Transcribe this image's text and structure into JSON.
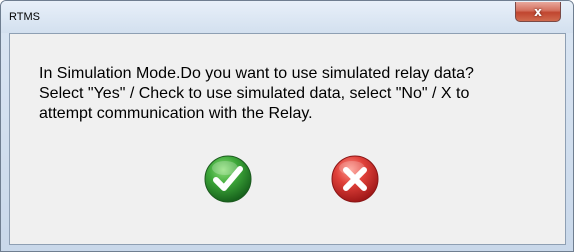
{
  "window": {
    "title": "RTMS",
    "close_glyph": "x"
  },
  "dialog": {
    "message_lines": [
      "In Simulation Mode.Do you want to use simulated relay data?",
      "Select \"Yes\" / Check to use simulated data, select \"No\" / X to",
      "attempt communication with the Relay."
    ]
  },
  "buttons": {
    "yes": {
      "icon": "check-icon",
      "color": "#2e8b2e"
    },
    "no": {
      "icon": "cross-icon",
      "color": "#d32f2f"
    }
  }
}
